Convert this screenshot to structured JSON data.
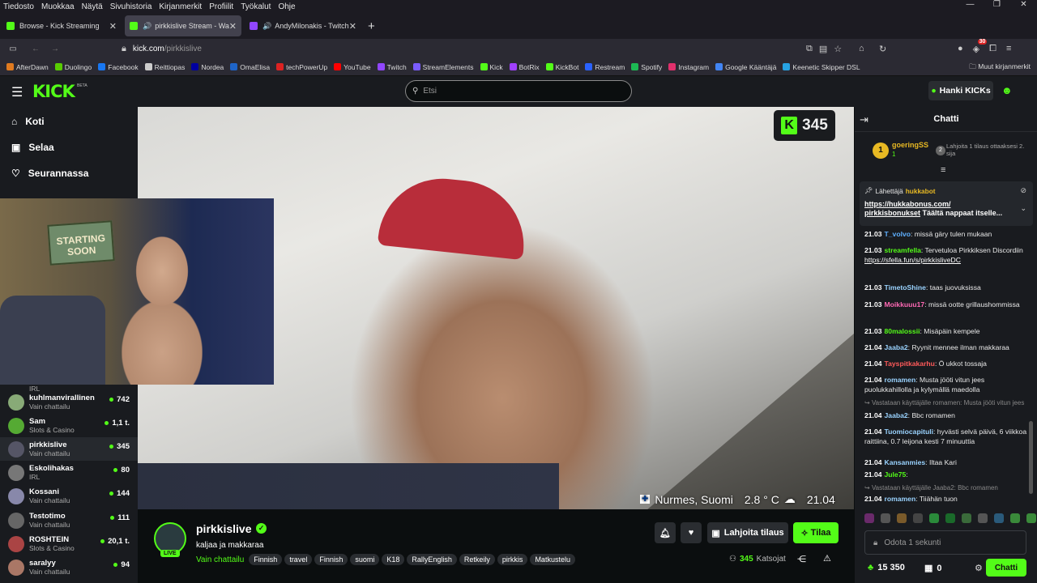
{
  "menubar": [
    "Tiedosto",
    "Muokkaa",
    "Näytä",
    "Sivuhistoria",
    "Kirjanmerkit",
    "Profiilit",
    "Työkalut",
    "Ohje"
  ],
  "tabs": [
    {
      "title": "Browse - Kick Streaming",
      "color": "#53fc18"
    },
    {
      "title": "pirkkislive Stream - Watch L",
      "color": "#53fc18",
      "audio": "🔊"
    },
    {
      "title": "AndyMilonakis - Twitch",
      "color": "#9146ff",
      "audio": "🔊"
    }
  ],
  "new_tab": "+",
  "url": {
    "host": "kick.com",
    "path": "/pirkkislive"
  },
  "toolbar": {
    "notif_count": "30"
  },
  "bookmarks": [
    {
      "label": "AfterDawn",
      "color": "#e07a1f"
    },
    {
      "label": "Duolingo",
      "color": "#58cc02"
    },
    {
      "label": "Facebook",
      "color": "#1877f2"
    },
    {
      "label": "Reittiopas",
      "color": "#cccccc"
    },
    {
      "label": "Nordea",
      "color": "#0000a0"
    },
    {
      "label": "OmaElisa",
      "color": "#1e64c8"
    },
    {
      "label": "techPowerUp",
      "color": "#d22"
    },
    {
      "label": "YouTube",
      "color": "#ff0000"
    },
    {
      "label": "Twitch",
      "color": "#9146ff"
    },
    {
      "label": "StreamElements",
      "color": "#7a5cff"
    },
    {
      "label": "Kick",
      "color": "#53fc18"
    },
    {
      "label": "BotRix",
      "color": "#a040ff"
    },
    {
      "label": "KickBot",
      "color": "#53fc18"
    },
    {
      "label": "Restream",
      "color": "#2a62ff"
    },
    {
      "label": "Spotify",
      "color": "#1db954"
    },
    {
      "label": "Instagram",
      "color": "#e1306c"
    },
    {
      "label": "Google Kääntäjä",
      "color": "#4285f4"
    },
    {
      "label": "Keenetic Skipper DSL",
      "color": "#27a3e3"
    }
  ],
  "other_bookmarks": "Muut kirjanmerkit",
  "kick": {
    "logo": "KICK",
    "beta": "BETA",
    "search_placeholder": "Etsi",
    "get_kicks": "Hanki KICKs"
  },
  "nav": [
    {
      "label": "Koti"
    },
    {
      "label": "Selaa"
    },
    {
      "label": "Seurannassa"
    }
  ],
  "channels": [
    {
      "name": "",
      "category": "IRL",
      "viewers": "",
      "color": "#665"
    },
    {
      "name": "kuhlmanvirallinen",
      "category": "Vain chattailu",
      "viewers": "742",
      "color": "#8a7"
    },
    {
      "name": "Sam",
      "category": "Slots & Casino",
      "viewers": "1,1 t.",
      "color": "#5a3"
    },
    {
      "name": "pirkkislive",
      "category": "Vain chattailu",
      "viewers": "345",
      "color": "#556"
    },
    {
      "name": "Eskolihakas",
      "category": "IRL",
      "viewers": "80",
      "color": "#777"
    },
    {
      "name": "Kossani",
      "category": "Vain chattailu",
      "viewers": "144",
      "color": "#88a"
    },
    {
      "name": "Testotimo",
      "category": "Vain chattailu",
      "viewers": "111",
      "color": "#666"
    },
    {
      "name": "ROSHTEIN",
      "category": "Slots & Casino",
      "viewers": "20,1 t.",
      "color": "#a44"
    },
    {
      "name": "saralyy",
      "category": "Vain chattailu",
      "viewers": "94",
      "color": "#a76"
    }
  ],
  "video": {
    "viewer_badge": "345",
    "location": "Nurmes, Suomi",
    "temp": "2.8 ° C",
    "time": "21.04"
  },
  "stream": {
    "name": "pirkkislive",
    "title": "kaljaa ja makkaraa",
    "category": "Vain chattailu",
    "live": "LIVE",
    "tags": [
      "Finnish",
      "travel",
      "Finnish",
      "suomi",
      "K18",
      "RallyEnglish",
      "Retkeily",
      "pirkkis",
      "Matkustelu"
    ],
    "gift": "Lahjoita tilaus",
    "subscribe": "Tilaa",
    "viewers": "345",
    "viewers_label": "Katsojat"
  },
  "chat": {
    "title": "Chatti",
    "leader": {
      "name": "goeringSS",
      "rank": "1",
      "count": "1",
      "note": "Lahjoita 1 tilaus ottaaksesi 2. sija",
      "rank2": "2"
    },
    "pinned": {
      "sender_label": "Lähettäjä",
      "sender": "hukkabot",
      "link1": "https://hukkabonus.com/",
      "link2": "pirkkisbonukset",
      "text": "Täältä nappaat itselle..."
    },
    "messages": [
      {
        "t": "21.03",
        "u": "T_volvo",
        "c": "#5fb0ff",
        "m": "missä gäry tulen mukaan"
      },
      {
        "t": "21.03",
        "u": "streamfella",
        "c": "#53fc18",
        "m": "Tervetuloa Pirkkiksen Discordiin ",
        "link": "https://sfella.fun/s/pirkkisliveDC"
      },
      {
        "t": "21.03",
        "u": "TimetoShine",
        "c": "#9ad3ff",
        "m": "taas juovuksissa"
      },
      {
        "t": "21.03",
        "u": "Moikkuuu17",
        "c": "#ff69b4",
        "m": "missä ootte grillaushommissa"
      },
      {
        "t": "21.03",
        "u": "80malossii",
        "c": "#53fc18",
        "m": "Misäpäin kempele"
      },
      {
        "t": "21.04",
        "u": "Jaaba2",
        "c": "#9ad3ff",
        "m": "Ryynit mennee ilman makkaraa"
      },
      {
        "t": "21.04",
        "u": "Tayspitkakarhu",
        "c": "#ff5a5a",
        "m": "Ö ukkot tossaja"
      },
      {
        "t": "21.04",
        "u": "romamen",
        "c": "#9ad3ff",
        "m": "Musta jööti vitun jees puolukkahillolla ja kylymällä maedolla"
      },
      {
        "t": "21.04",
        "u": "Jaaba2",
        "c": "#9ad3ff",
        "m": "Bbc romamen"
      },
      {
        "t": "21.04",
        "u": "Tuomiocapituli",
        "c": "#9ad3ff",
        "m": "hyvästi selvä päivä, 6 viikkoa raittiina, 0.7 leijona kesti 7 minuuttia"
      },
      {
        "t": "21.04",
        "u": "Kansanmies",
        "c": "#9ad3ff",
        "m": "Iltaa Kari"
      },
      {
        "t": "21.04",
        "u": "Jule75",
        "c": "#53fc18",
        "m": ""
      },
      {
        "t": "21.04",
        "u": "romamen",
        "c": "#9ad3ff",
        "m": "Tiiähän tuon"
      }
    ],
    "replies": [
      "Vastataan käyttäjälle romamen: Musta jööti vitun jees",
      "Vastataan käyttäjälle Jaaba2: Bbc romamen"
    ],
    "input_placeholder": "Odota 1 sekunti",
    "points": "15 350",
    "gifts": "0",
    "send": "Chatti"
  }
}
